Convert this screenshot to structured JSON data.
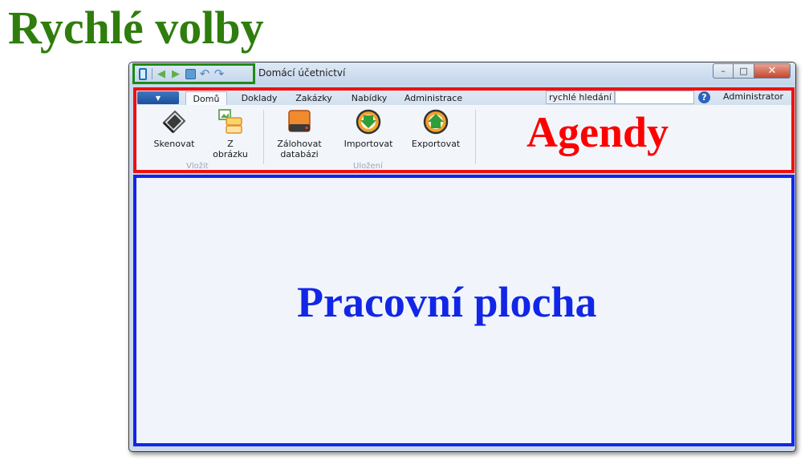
{
  "annotations": {
    "quick_access": "Rychlé volby",
    "agendas": "Agendy",
    "workspace": "Pracovní plocha"
  },
  "window": {
    "title": "Domácí účetnictví",
    "controls": {
      "minimize": "–",
      "maximize": "□",
      "close": "✕"
    }
  },
  "ribbon": {
    "tabs": [
      {
        "label": "Domů",
        "active": true
      },
      {
        "label": "Doklady"
      },
      {
        "label": "Zakázky"
      },
      {
        "label": "Nabídky"
      },
      {
        "label": "Administrace"
      }
    ],
    "search": {
      "label": "rychlé hledání",
      "value": ""
    },
    "help": "?",
    "user": "Administrator",
    "buttons": [
      {
        "label": "Skenovat",
        "icon": "scanner-icon"
      },
      {
        "label": "Z\nobrázku",
        "icon": "image-import-icon"
      },
      {
        "label": "Zálohovat\ndatabázi",
        "icon": "database-backup-icon"
      },
      {
        "label": "Importovat",
        "icon": "import-down-icon"
      },
      {
        "label": "Exportovat",
        "icon": "export-up-icon"
      }
    ],
    "groups": [
      {
        "label": "Vložit"
      },
      {
        "label": "Uložení"
      }
    ]
  },
  "colors": {
    "quick_access_border": "#1f8a14",
    "ribbon_border": "#ee1111",
    "workspace_border": "#1226e6",
    "label_green": "#2f7d0c",
    "label_red": "#ff0000",
    "label_blue": "#1226e6"
  }
}
